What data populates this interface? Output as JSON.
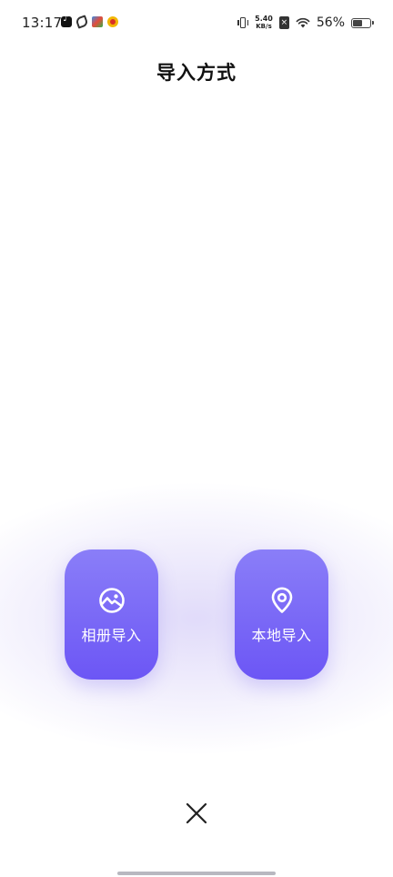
{
  "status_bar": {
    "time": "13:17",
    "net_speed_value": "5.40",
    "net_speed_unit": "KB/s",
    "sim_badge": "×",
    "battery_percent": "56%",
    "battery_level": 0.56
  },
  "page": {
    "title": "导入方式"
  },
  "options": [
    {
      "label": "相册导入",
      "icon": "image-icon"
    },
    {
      "label": "本地导入",
      "icon": "location-pin-icon"
    }
  ],
  "colors": {
    "card_top": "#8a7ef8",
    "card_bottom": "#6c56f5",
    "glow": "#c8bef5"
  },
  "close": {
    "icon": "close-icon"
  }
}
